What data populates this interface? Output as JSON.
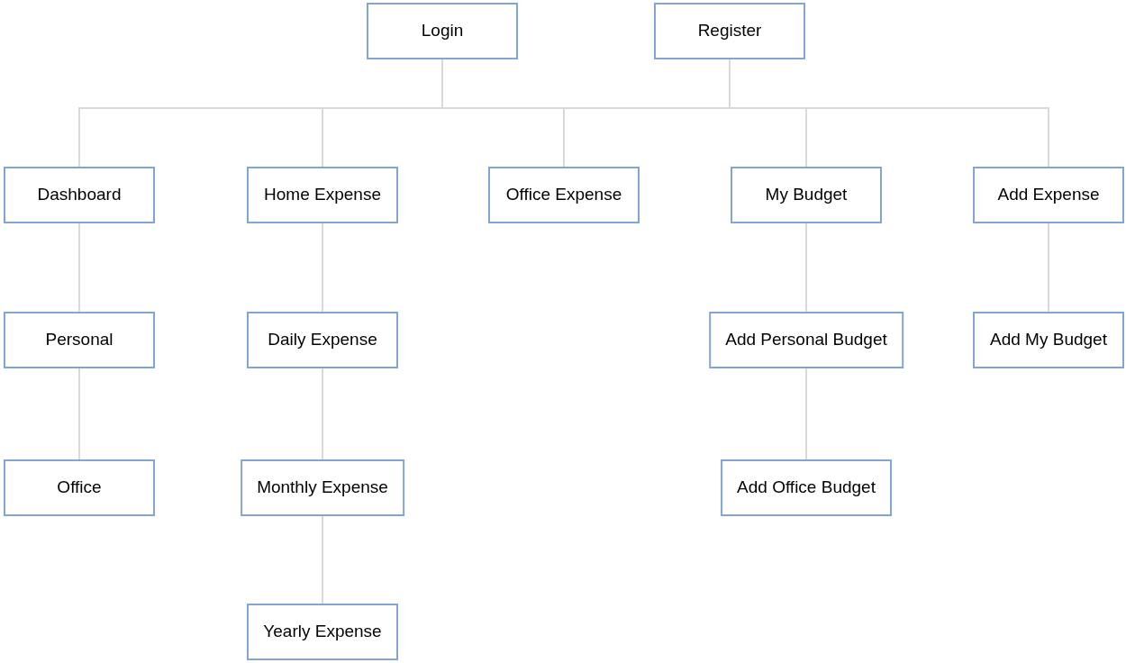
{
  "top_nodes": [
    {
      "label": "Login"
    },
    {
      "label": "Register"
    }
  ],
  "branches": [
    {
      "label": "Dashboard",
      "children": [
        {
          "label": "Personal",
          "children": [
            {
              "label": "Office"
            }
          ]
        }
      ]
    },
    {
      "label": "Home Expense",
      "children": [
        {
          "label": "Daily Expense",
          "children": [
            {
              "label": "Monthly Expense",
              "children": [
                {
                  "label": "Yearly Expense"
                }
              ]
            }
          ]
        }
      ]
    },
    {
      "label": "Office Expense"
    },
    {
      "label": "My Budget",
      "children": [
        {
          "label": "Add Personal Budget",
          "children": [
            {
              "label": "Add Office Budget"
            }
          ]
        }
      ]
    },
    {
      "label": "Add Expense",
      "children": [
        {
          "label": "Add My Budget"
        }
      ]
    }
  ]
}
